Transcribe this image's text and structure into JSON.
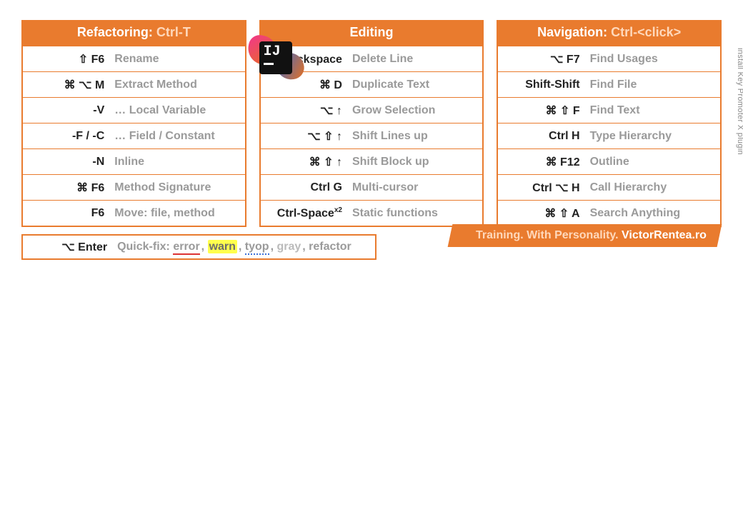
{
  "columns": [
    {
      "title_prefix": "Refactoring: ",
      "title_suffix": "Ctrl-T",
      "rows": [
        {
          "key": "⇧ F6",
          "desc": "Rename"
        },
        {
          "key": "⌘ ⌥ M",
          "desc": "Extract Method"
        },
        {
          "key": "-V",
          "desc": "… Local Variable"
        },
        {
          "key": "-F / -C",
          "desc": "… Field / Constant"
        },
        {
          "key": "-N",
          "desc": "Inline"
        },
        {
          "key": "⌘ F6",
          "desc": "Method Signature"
        },
        {
          "key": "F6",
          "desc": "Move: file, method"
        }
      ]
    },
    {
      "title_prefix": "Editing",
      "title_suffix": "",
      "rows": [
        {
          "key": "⌘ Backspace",
          "desc": "Delete Line"
        },
        {
          "key": "⌘ D",
          "desc": "Duplicate Text"
        },
        {
          "key": "⌥ ↑",
          "desc": "Grow Selection"
        },
        {
          "key": "⌥ ⇧ ↑",
          "desc": "Shift Lines up"
        },
        {
          "key": "⌘ ⇧ ↑",
          "desc": "Shift Block up"
        },
        {
          "key": "Ctrl G",
          "desc": "Multi-cursor"
        },
        {
          "key_html": "Ctrl-Space<sup>x2</sup>",
          "desc": "Static functions"
        }
      ]
    },
    {
      "title_prefix": "Navigation: ",
      "title_suffix": "Ctrl-<click>",
      "rows": [
        {
          "key": "⌥ F7",
          "desc": "Find Usages"
        },
        {
          "key": "Shift-Shift",
          "desc": "Find File"
        },
        {
          "key": "⌘ ⇧ F",
          "desc": "Find Text"
        },
        {
          "key": "Ctrl H",
          "desc": "Type Hierarchy"
        },
        {
          "key": "⌘ F12",
          "desc": "Outline"
        },
        {
          "key": "Ctrl ⌥ H",
          "desc": "Call Hierarchy"
        },
        {
          "key": "⌘ ⇧ A",
          "desc": "Search Anything"
        }
      ]
    }
  ],
  "quickfix": {
    "key": "⌥ Enter",
    "lead": "Quick-fix: ",
    "parts": {
      "error": "error",
      "warn": "warn",
      "tyop": "tyop",
      "gray": "gray",
      "refactor": "refactor"
    }
  },
  "footer": {
    "subtle": "Training. With Personality. ",
    "bold": "VictorRentea.ro"
  },
  "side_note": "install Key Promoter X plugin",
  "ij": {
    "label": "IJ"
  }
}
